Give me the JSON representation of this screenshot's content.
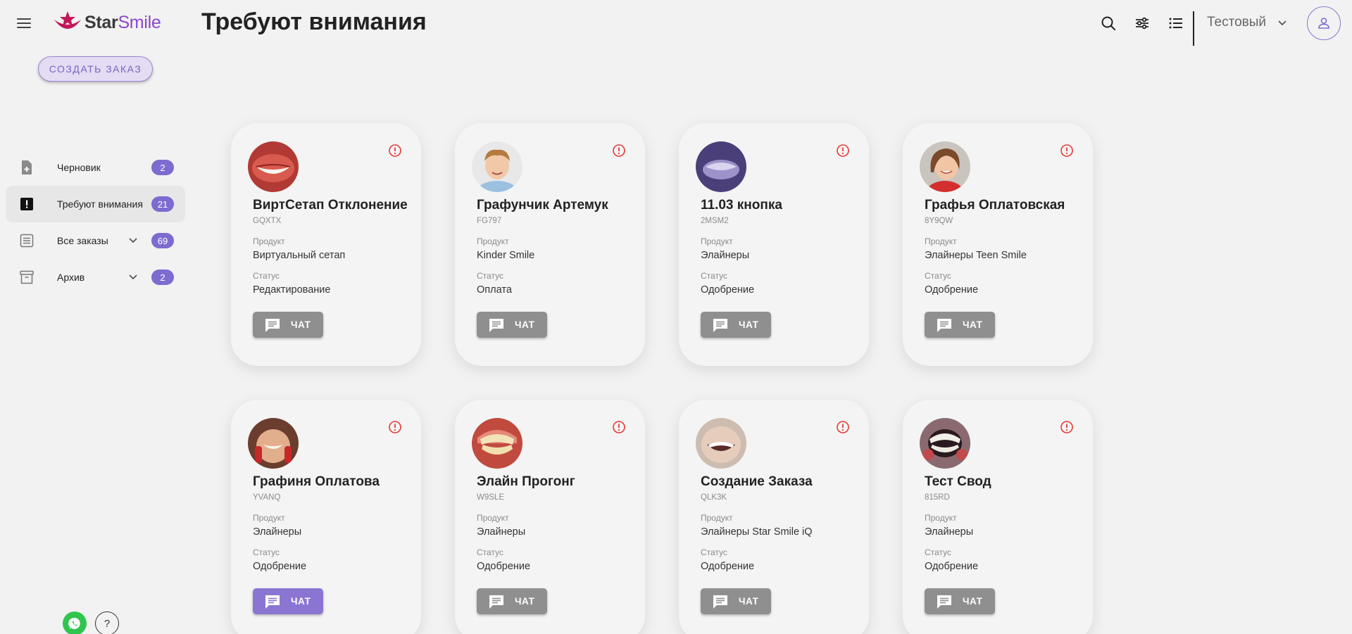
{
  "header": {
    "brand_part1": "Star",
    "brand_part2": "Smile",
    "title": "Требуют внимания",
    "user_label": "Тестовый"
  },
  "create_button": "СОЗДАТЬ ЗАКАЗ",
  "sidebar": {
    "items": [
      {
        "label": "Черновик",
        "count": "2",
        "icon": "file-plus-icon"
      },
      {
        "label": "Требуют внимания",
        "count": "21",
        "icon": "exclamation-square-icon",
        "active": true
      },
      {
        "label": "Все заказы",
        "count": "69",
        "icon": "list-doc-icon",
        "expandable": true
      },
      {
        "label": "Архив",
        "count": "2",
        "icon": "archive-icon",
        "expandable": true
      }
    ]
  },
  "help_label": "?",
  "field_labels": {
    "product": "Продукт",
    "status": "Статус",
    "chat": "ЧАТ"
  },
  "cards": [
    {
      "name": "ВиртСетап Отклонение",
      "code": "GQXTX",
      "product": "Виртуальный сетап",
      "status": "Редактирование"
    },
    {
      "name": "Графунчик Артемук",
      "code": "FG797",
      "product": "Kinder Smile",
      "status": "Оплата"
    },
    {
      "name": "11.03 кнопка",
      "code": "2MSM2",
      "product": "Элайнеры",
      "status": "Одобрение"
    },
    {
      "name": "Графья Оплатовская",
      "code": "8Y9QW",
      "product": "Элайнеры Teen Smile",
      "status": "Одобрение"
    },
    {
      "name": "Графиня Оплатова",
      "code": "YVANQ",
      "product": "Элайнеры",
      "status": "Одобрение"
    },
    {
      "name": "Элайн Прогонг",
      "code": "W9SLE",
      "product": "Элайнеры",
      "status": "Одобрение"
    },
    {
      "name": "Создание Заказа",
      "code": "QLK3K",
      "product": "Элайнеры Star Smile iQ",
      "status": "Одобрение"
    },
    {
      "name": "Тест Свод",
      "code": "815RD",
      "product": "Элайнеры",
      "status": "Одобрение"
    }
  ],
  "colors": {
    "accent": "#7e6bd0",
    "alert": "#e53935",
    "chat_button": "#8f8f8f",
    "chat_button_active": "#8b75d2"
  }
}
